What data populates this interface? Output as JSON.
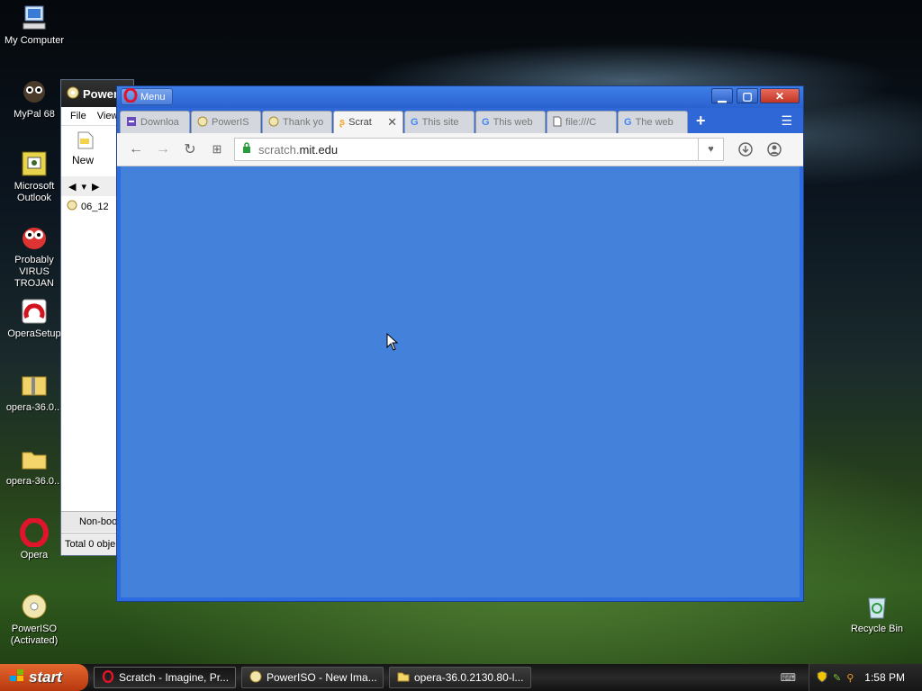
{
  "desktop": {
    "icons": [
      {
        "label": "My Computer",
        "icon": "my-computer-icon"
      },
      {
        "label": "MyPal 68",
        "icon": "mypal-icon"
      },
      {
        "label": "Microsoft Outlook",
        "icon": "outlook-icon"
      },
      {
        "label": "Probably VIRUS TROJAN",
        "icon": "virus-icon"
      },
      {
        "label": "OperaSetup",
        "icon": "opera-setup-icon"
      },
      {
        "label": "opera-36.0...",
        "icon": "zip-folder-icon"
      },
      {
        "label": "opera-36.0...",
        "icon": "folder-icon"
      },
      {
        "label": "Opera",
        "icon": "opera-icon"
      },
      {
        "label": "PowerISO (Activated)",
        "icon": "poweriso-icon"
      },
      {
        "label": "Recycle Bin",
        "icon": "recycle-bin-icon"
      }
    ]
  },
  "poweriso": {
    "title": "Power",
    "menu": [
      "File",
      "View"
    ],
    "toolbar_new": "New",
    "row_item": "06_12",
    "status_top": "Non-boo",
    "status_bottom": "Total 0 obje"
  },
  "opera": {
    "menu_label": "Menu",
    "tabs": [
      {
        "label": "Downloa",
        "icon": "downloads-icon",
        "active": false
      },
      {
        "label": "PowerIS",
        "icon": "poweriso-icon",
        "active": false
      },
      {
        "label": "Thank yo",
        "icon": "poweriso-icon",
        "active": false
      },
      {
        "label": "Scrat",
        "icon": "scratch-icon",
        "active": true
      },
      {
        "label": "This site",
        "icon": "google-icon",
        "active": false
      },
      {
        "label": "This web",
        "icon": "google-icon",
        "active": false
      },
      {
        "label": "file:///C",
        "icon": "file-icon",
        "active": false
      },
      {
        "label": "The web",
        "icon": "google-icon",
        "active": false
      }
    ],
    "address": {
      "prefix": "scratch.",
      "domain": "mit.edu"
    },
    "content_color": "#4381db"
  },
  "taskbar": {
    "start": "start",
    "tasks": [
      {
        "label": "Scratch - Imagine, Pr...",
        "icon": "opera-icon",
        "active": true
      },
      {
        "label": "PowerISO - New Ima...",
        "icon": "poweriso-icon",
        "active": false
      },
      {
        "label": "opera-36.0.2130.80-l...",
        "icon": "folder-icon",
        "active": false
      }
    ],
    "clock": "1:58 PM"
  }
}
